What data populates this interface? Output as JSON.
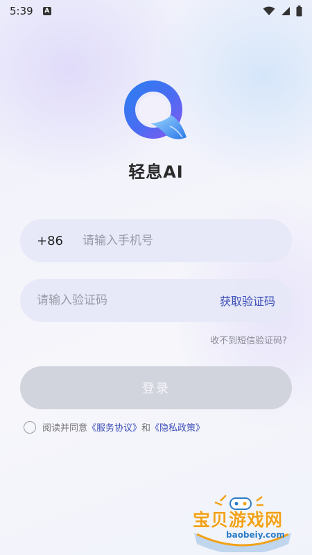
{
  "status_bar": {
    "time": "5:39",
    "indicator_letter": "A"
  },
  "app": {
    "name": "轻息AI"
  },
  "phone": {
    "country_code": "+86",
    "placeholder": "请输入手机号"
  },
  "code": {
    "placeholder": "请输入验证码",
    "get_code_label": "获取验证码"
  },
  "no_sms_label": "收不到短信验证码?",
  "login_label": "登录",
  "agreement": {
    "prefix": "阅读并同意",
    "service_link": "《服务协议》",
    "and": "和",
    "privacy_link": "《隐私政策》"
  },
  "watermark": {
    "text": "宝贝游戏网",
    "url": "baobeiy.com"
  },
  "colors": {
    "accent": "#3d4fb8",
    "button_disabled": "#d1d3dd",
    "watermark_orange": "#f1a21a"
  }
}
